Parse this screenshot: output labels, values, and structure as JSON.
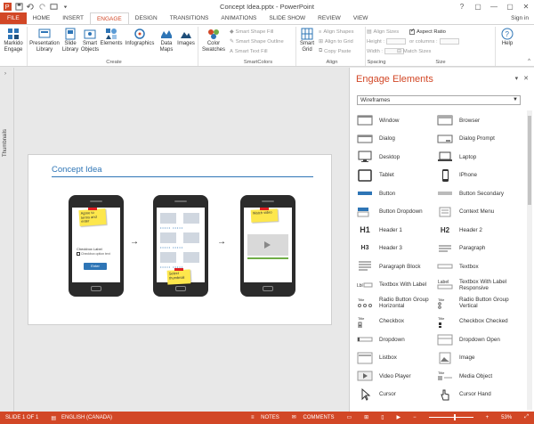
{
  "window": {
    "title": "Concept Idea.pptx - PowerPoint",
    "controls": [
      "?",
      "▢",
      "—",
      "▢",
      "✕"
    ]
  },
  "tabs": [
    "FILE",
    "HOME",
    "INSERT",
    "ENGAGE",
    "DESIGN",
    "TRANSITIONS",
    "ANIMATIONS",
    "SLIDE SHOW",
    "REVIEW",
    "VIEW"
  ],
  "active_tab": "ENGAGE",
  "signin": "Sign in",
  "ribbon": {
    "markido": "Markido Engage",
    "presentation_library": "Presentation Library",
    "slide_library": "Slide Library",
    "smart_objects": "Smart Objects",
    "elements": "Elements",
    "infographics": "Infographics",
    "data_maps": "Data Maps",
    "images": "Images",
    "color_swatches": "Color Swatches",
    "smart_shape_fill": "Smart Shape Fill",
    "smart_shape_outline": "Smart Shape Outline",
    "smart_text_fill": "Smart Text Fill",
    "smart_grid": "Smart Grid",
    "align_shapes": "Align Shapes",
    "align_to_grid": "Align to Grid",
    "copy": "Copy",
    "paste": "Paste",
    "align_sizes": "Align Sizes",
    "height": "Height :",
    "width": "Width :",
    "aspect_ratio": "Aspect Ratio",
    "or_columns": "or columns :",
    "match_sizes": "Match Sizes",
    "help": "Help",
    "groups": {
      "create": "Create",
      "smartcolors": "SmartColors",
      "align": "Align",
      "spacing": "Spacing",
      "size": "Size"
    }
  },
  "thumbnails_label": "Thumbnails",
  "slide": {
    "title": "Concept Idea",
    "phone1": {
      "note": "Agree to terms and enter",
      "checkbox_label": "Checkbox Label",
      "checkbox_option": "Checkbox option text",
      "button": "Enter"
    },
    "phone2": {
      "note": "Select thumbnail"
    },
    "phone3": {
      "note": "Watch video"
    }
  },
  "pane": {
    "title": "Engage Elements",
    "dropdown": "Wireframes",
    "items": [
      "Window",
      "Browser",
      "Dialog",
      "Dialog Prompt",
      "Desktop",
      "Laptop",
      "Tablet",
      "IPhone",
      "Button",
      "Button Secondary",
      "Button Dropdown",
      "Context Menu",
      "Header 1",
      "Header 2",
      "Header 3",
      "Paragraph",
      "Paragraph Block",
      "Textbox",
      "Textbox With Label",
      "Textbox With Label Responsive",
      "Radio Button Group Horizontal",
      "Radio Button Group Vertical",
      "Checkbox",
      "Checkbox Checked",
      "Dropdown",
      "Dropdown Open",
      "Listbox",
      "Image",
      "Video Player",
      "Media Object",
      "Cursor",
      "Cursor Hand"
    ]
  },
  "status": {
    "slide": "SLIDE 1 OF 1",
    "language": "ENGLISH (CANADA)",
    "notes": "NOTES",
    "comments": "COMMENTS",
    "zoom": "53%"
  },
  "colors": {
    "accent": "#d24726",
    "slide_title": "#2e75b6",
    "sticky": "#fde74c"
  }
}
